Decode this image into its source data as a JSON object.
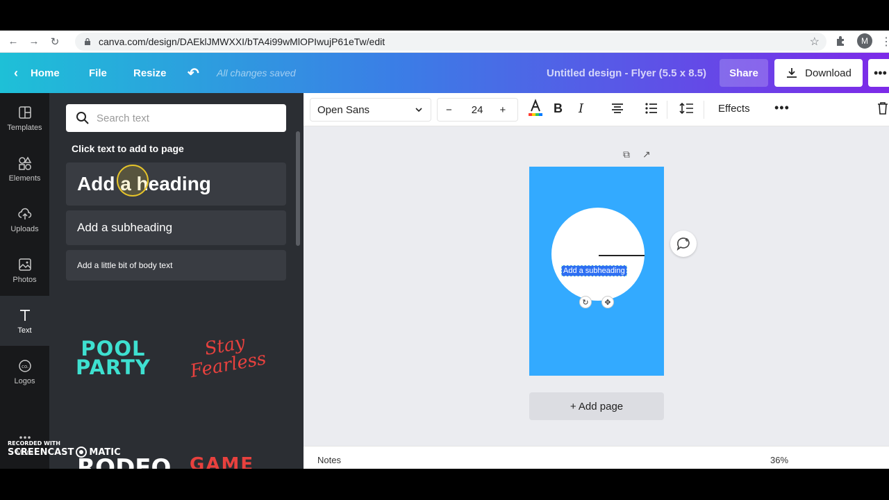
{
  "browser": {
    "url": "canva.com/design/DAEklJMWXXI/bTA4i99wMlOPIwujP61eTw/edit",
    "profile_initial": "M"
  },
  "topbar": {
    "home": "Home",
    "file": "File",
    "resize": "Resize",
    "saved_status": "All changes saved",
    "design_title": "Untitled design - Flyer (5.5 x 8.5)",
    "share": "Share",
    "download": "Download"
  },
  "sidebar": {
    "items": [
      {
        "label": "Templates",
        "icon": "templates-icon"
      },
      {
        "label": "Elements",
        "icon": "elements-icon"
      },
      {
        "label": "Uploads",
        "icon": "uploads-icon"
      },
      {
        "label": "Photos",
        "icon": "photos-icon"
      },
      {
        "label": "Text",
        "icon": "text-icon"
      },
      {
        "label": "Logos",
        "icon": "logos-icon"
      },
      {
        "label": "More",
        "icon": "more-icon"
      }
    ]
  },
  "panel": {
    "search_placeholder": "Search text",
    "section_label": "Click text to add to page",
    "add_heading": "Add a heading",
    "add_subheading": "Add a subheading",
    "add_body": "Add a little bit of body text",
    "templates": {
      "pool_line1": "POOL",
      "pool_line2": "PARTY",
      "stay_line1": "Stay",
      "stay_line2": "Fearless",
      "rodeo": "RODEO",
      "game": "GAME"
    }
  },
  "watermark": {
    "line1": "RECORDED WITH",
    "line2a": "SCREENCAST",
    "line2b": "MATIC"
  },
  "toolbar": {
    "font": "Open Sans",
    "font_size": "24",
    "minus": "−",
    "plus": "+",
    "effects": "Effects"
  },
  "canvas": {
    "page_color": "#33aaff",
    "selected_text": "Add a subheading",
    "add_page": "+ Add page",
    "notes": "Notes",
    "zoom": "36%"
  },
  "colors": {
    "accent": "#7d2ae8",
    "panel_bg": "#2b2e33",
    "sidebar_bg": "#18191b"
  }
}
